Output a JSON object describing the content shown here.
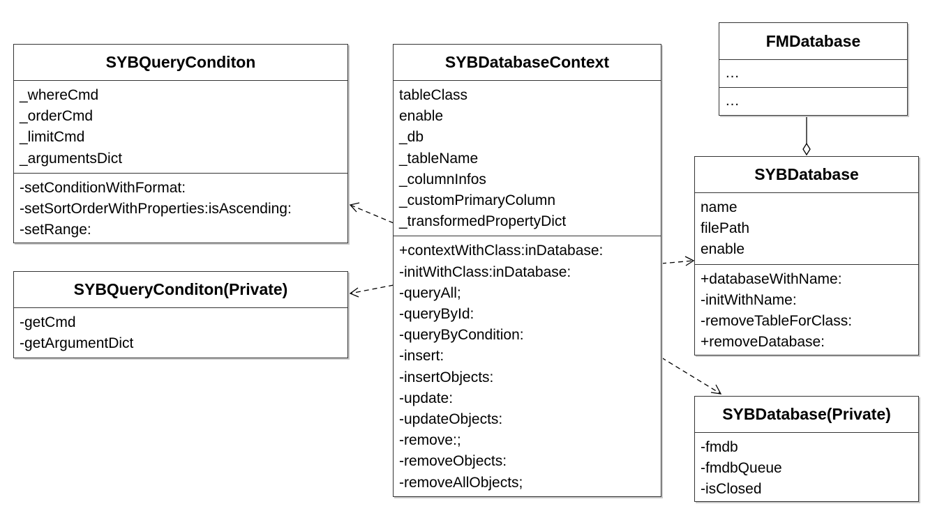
{
  "classes": {
    "query_condition": {
      "name": "SYBQueryConditon",
      "attributes": [
        "_whereCmd",
        "_orderCmd",
        "_limitCmd",
        "_argumentsDict"
      ],
      "methods": [
        "-setConditionWithFormat:",
        "-setSortOrderWithProperties:isAscending:",
        "-setRange:"
      ]
    },
    "query_condition_private": {
      "name": "SYBQueryConditon(Private)",
      "methods": [
        "-getCmd",
        "-getArgumentDict"
      ]
    },
    "database_context": {
      "name": "SYBDatabaseContext",
      "attributes": [
        "tableClass",
        "enable",
        "_db",
        "_tableName",
        "_columnInfos",
        "_customPrimaryColumn",
        "_transformedPropertyDict"
      ],
      "methods": [
        "+contextWithClass:inDatabase:",
        "-initWithClass:inDatabase:",
        "-queryAll;",
        "-queryById:",
        "-queryByCondition:",
        "-insert:",
        "-insertObjects:",
        "-update:",
        "-updateObjects:",
        "-remove:;",
        "-removeObjects:",
        "-removeAllObjects;"
      ]
    },
    "fm_database": {
      "name": "FMDatabase",
      "attributes": [
        "…"
      ],
      "methods": [
        "…"
      ]
    },
    "database": {
      "name": "SYBDatabase",
      "attributes": [
        "name",
        "filePath",
        "enable"
      ],
      "methods": [
        "+databaseWithName:",
        "-initWithName:",
        "-removeTableForClass:",
        "+removeDatabase:"
      ]
    },
    "database_private": {
      "name": "SYBDatabase(Private)",
      "methods": [
        "-fmdb",
        "-fmdbQueue",
        "-isClosed"
      ]
    }
  },
  "colors": {
    "border": "#333333",
    "shadow": "#c8c8c8",
    "line": "#000000"
  }
}
